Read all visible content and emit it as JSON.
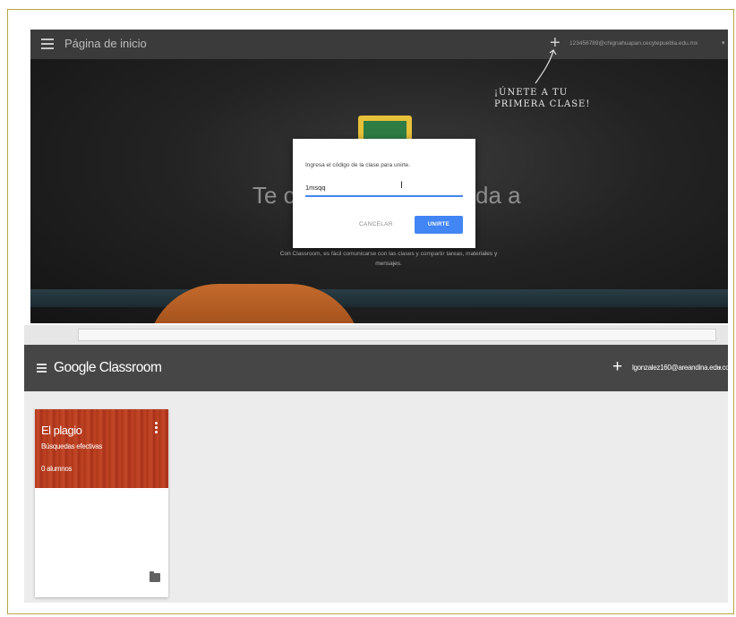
{
  "join_screen": {
    "title": "Página de inicio",
    "plus": "+",
    "account": "123456789@chignahuapan.cecytepuebla.edu.mx",
    "caret": "▾",
    "hint": "¡ÚNETE A TU\nPRIMERA CLASE!",
    "background_text_left": "Te c",
    "background_text_right": "da a",
    "subtext": "Con Classroom, es fácil comunicarse con las clases y compartir tareas, materiales y mensajes.",
    "dialog": {
      "prompt": "Ingresa el código de la clase para unirte.",
      "code_value": "1msqq",
      "cancel_label": "CANCELAR",
      "join_label": "UNIRTE"
    },
    "colors": {
      "accent": "#4285f4",
      "bar": "#3b3b3b"
    }
  },
  "classroom_screen": {
    "brand": "Google Classroom",
    "plus": "+",
    "account": "lgonzalez160@areandina.edu.co",
    "caret": "▾",
    "card": {
      "title": "El plagio",
      "section": "Búsquedas efectivas",
      "students": "0 alumnos",
      "header_color": "#b63a1d"
    },
    "colors": {
      "appbar": "#464646",
      "background": "#ececec"
    }
  }
}
